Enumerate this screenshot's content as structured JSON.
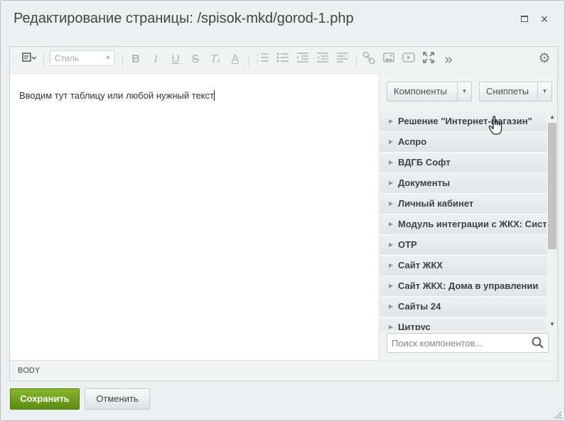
{
  "window": {
    "title": "Редактирование страницы: /spisok-mkd/gorod-1.php",
    "maximize_label": "□",
    "close_label": "×"
  },
  "toolbar": {
    "style_placeholder": "Стиль",
    "icons": [
      "source-mode-icon",
      "bold-icon",
      "italic-icon",
      "underline-icon",
      "strikethrough-icon",
      "clear-format-icon",
      "font-color-icon",
      "ordered-list-icon",
      "unordered-list-icon",
      "outdent-icon",
      "indent-icon",
      "align-icon",
      "link-icon",
      "image-icon",
      "video-icon",
      "fullscreen-icon",
      "more-icon",
      "settings-icon"
    ]
  },
  "content": {
    "text": "Вводим тут таблицу или любой нужный текст"
  },
  "panel": {
    "components_label": "Компоненты",
    "snippets_label": "Сниппеты",
    "items": [
      "Решение \"Интернет-магазин\"",
      "Аспро",
      "ВДГБ Софт",
      "Документы",
      "Личный кабинет",
      "Модуль интеграции с ЖКХ: Система расчетов",
      "ОТР",
      "Сайт ЖКХ",
      "Сайт ЖКХ: Дома в управлении",
      "Сайты 24",
      "Цитрус"
    ],
    "search_placeholder": "Поиск компонентов..."
  },
  "status": {
    "tag": "BODY"
  },
  "footer": {
    "save_label": "Сохранить",
    "cancel_label": "Отменить"
  },
  "colors": {
    "save_button": "#6fa11f",
    "dialog_bg": "#edf0f0",
    "panel_bg": "#f1f3f3"
  }
}
